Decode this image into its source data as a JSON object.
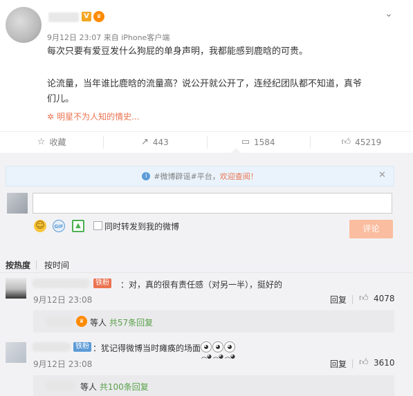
{
  "post": {
    "timestamp": "9月12日 23:07",
    "source": "来自 iPhone客户端",
    "vip_badge_text": "V",
    "paragraph1": "每次只要有爱豆发什么狗屁的单身声明，我都能感到鹿晗的可贵。",
    "paragraph2_line1": "论流量，当年谁比鹿晗的流量高？说公开就公开了，连经纪团队都不知道，真爷",
    "paragraph2_line2": "们儿。",
    "topic_link": "明星不为人知的情史..."
  },
  "actions": {
    "favorite": "收藏",
    "repost_count": "443",
    "comment_count": "1584",
    "like_count": "45219"
  },
  "notice": {
    "prefix": "#微博辟谣#平台，",
    "link": "欢迎查阅！"
  },
  "composer": {
    "repost_checkbox_label": "同时转发到我的微博",
    "submit": "评论"
  },
  "sort": {
    "hot": "按热度",
    "time": "按时间"
  },
  "comments": [
    {
      "badge": "铁粉",
      "text": "：对，真的很有责任感（对另一半），挺好的",
      "time": "9月12日 23:08",
      "reply": "回复",
      "likes": "4078",
      "sub_suffix": "等人",
      "sub_count": "共57条回复"
    },
    {
      "badge": "铁粉",
      "text": "：犹记得微博当时瘫痪的场面",
      "time": "9月12日 23:08",
      "reply": "回复",
      "likes": "3610",
      "sub_suffix": "等人",
      "sub_count": "共100条回复"
    }
  ],
  "colors": {
    "accent": "#eb7350",
    "fan_badge_1": "#eb7350",
    "fan_badge_2": "#5c9bd6",
    "sub_count": "#5aa14a"
  },
  "icons": {
    "favorite": "star-icon",
    "repost": "share-icon",
    "comment": "comment-icon",
    "like": "thumbs-up-icon"
  }
}
